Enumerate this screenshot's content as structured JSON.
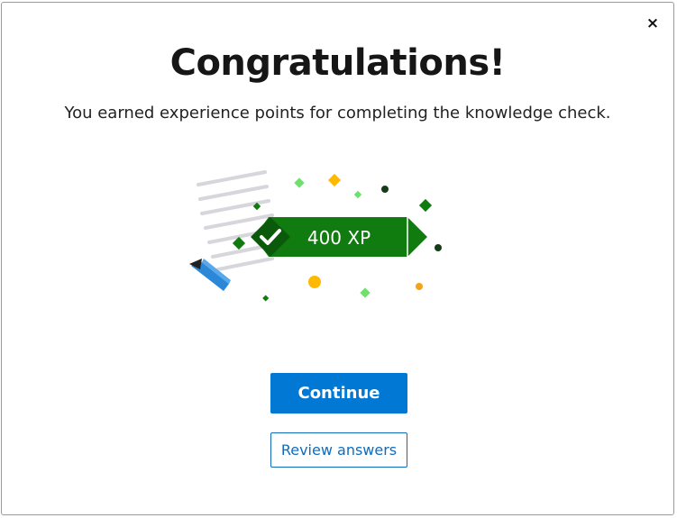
{
  "dialog": {
    "close_label": "×",
    "title": "Congratulations!",
    "subtitle": "You earned experience points for completing the knowledge check.",
    "badge": {
      "xp_text": "400 XP",
      "check_icon": "checkmark-icon",
      "pencil_icon": "pencil-icon",
      "document_icon": "document-lines-icon"
    },
    "primary_button_label": "Continue",
    "secondary_button_label": "Review answers"
  },
  "colors": {
    "primary_blue": "#0078d4",
    "link_blue": "#0f6cbd",
    "badge_green": "#107c10",
    "badge_dark_green": "#0b5a0b",
    "confetti_gold": "#ffb900",
    "confetti_light_green": "#6ee06e",
    "confetti_orange": "#f7a21b"
  }
}
